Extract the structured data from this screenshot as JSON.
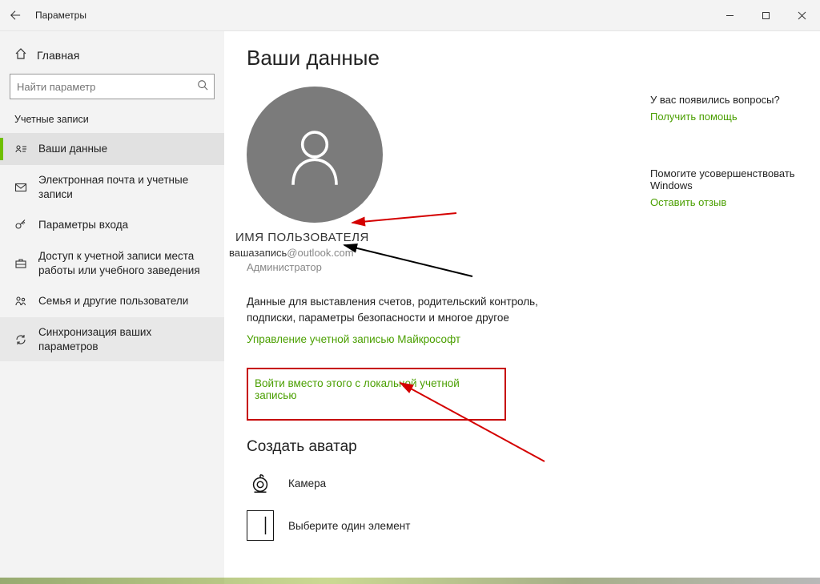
{
  "titlebar": {
    "title": "Параметры"
  },
  "sidebar": {
    "home": "Главная",
    "search_placeholder": "Найти параметр",
    "section": "Учетные записи",
    "items": [
      {
        "label": "Ваши данные"
      },
      {
        "label": "Электронная почта и учетные записи"
      },
      {
        "label": "Параметры входа"
      },
      {
        "label": "Доступ к учетной записи места работы или учебного заведения"
      },
      {
        "label": "Семья и другие пользователи"
      },
      {
        "label": "Синхронизация ваших параметров"
      }
    ]
  },
  "main": {
    "heading": "Ваши данные",
    "user_name": "ИМЯ ПОЛЬЗОВАТЕЛЯ",
    "user_email_local": "вашазапись",
    "user_email_domain": "@outlook.com",
    "user_role": "Администратор",
    "desc": "Данные для выставления счетов, родительский контроль, подписки, параметры безопасности и многое другое",
    "manage_link": "Управление учетной записью Майкрософт",
    "local_signin_link": "Войти вместо этого с локальной учетной записью",
    "create_avatar_heading": "Создать аватар",
    "camera_label": "Камера",
    "browse_label": "Выберите один элемент"
  },
  "right": {
    "q1": "У вас появились вопросы?",
    "l1": "Получить помощь",
    "q2": "Помогите усовершенствовать Windows",
    "l2": "Оставить отзыв"
  }
}
